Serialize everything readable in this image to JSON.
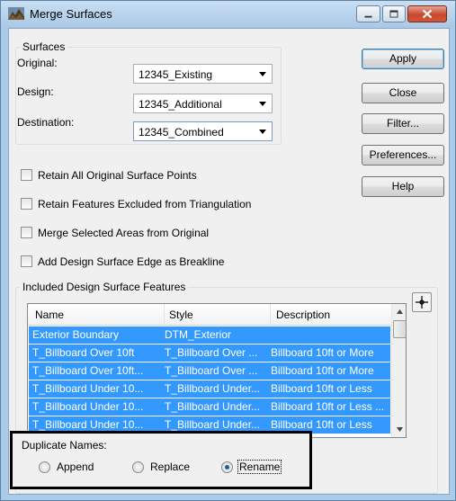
{
  "window": {
    "title": "Merge Surfaces",
    "icon": "mountains-app-icon"
  },
  "surfaces": {
    "group_label": "Surfaces",
    "original_label": "Original:",
    "original_value": "12345_Existing",
    "design_label": "Design:",
    "design_value": "12345_Additional",
    "destination_label": "Destination:",
    "destination_value": "12345_Combined"
  },
  "buttons": {
    "apply": "Apply",
    "close": "Close",
    "filter": "Filter...",
    "preferences": "Preferences...",
    "help": "Help"
  },
  "options": [
    {
      "label": "Retain All Original Surface Points",
      "checked": false
    },
    {
      "label": "Retain Features Excluded from Triangulation",
      "checked": false
    },
    {
      "label": "Merge Selected Areas from Original",
      "checked": false
    },
    {
      "label": "Add Design Surface Edge as Breakline",
      "checked": false
    }
  ],
  "features": {
    "group_label": "Included Design Surface Features",
    "columns": [
      "Name",
      "Style",
      "Description"
    ],
    "rows": [
      [
        "Exterior Boundary",
        "DTM_Exterior",
        ""
      ],
      [
        "T_Billboard Over 10ft",
        "T_Billboard Over ...",
        "Billboard 10ft or More"
      ],
      [
        "T_Billboard Over 10ft...",
        "T_Billboard Over ...",
        "Billboard 10ft or More"
      ],
      [
        "T_Billboard Under 10...",
        "T_Billboard Under...",
        "Billboard 10ft or Less"
      ],
      [
        "T_Billboard Under 10...",
        "T_Billboard Under...",
        "Billboard 10ft or Less ..."
      ],
      [
        "T_Billboard Under 10...",
        "T_Billboard Under...",
        "Billboard 10ft or Less"
      ]
    ],
    "selection_color": "#3399ff"
  },
  "duplicate_names": {
    "label": "Duplicate Names:",
    "options": [
      "Append",
      "Replace",
      "Rename"
    ],
    "selected": "Rename"
  }
}
